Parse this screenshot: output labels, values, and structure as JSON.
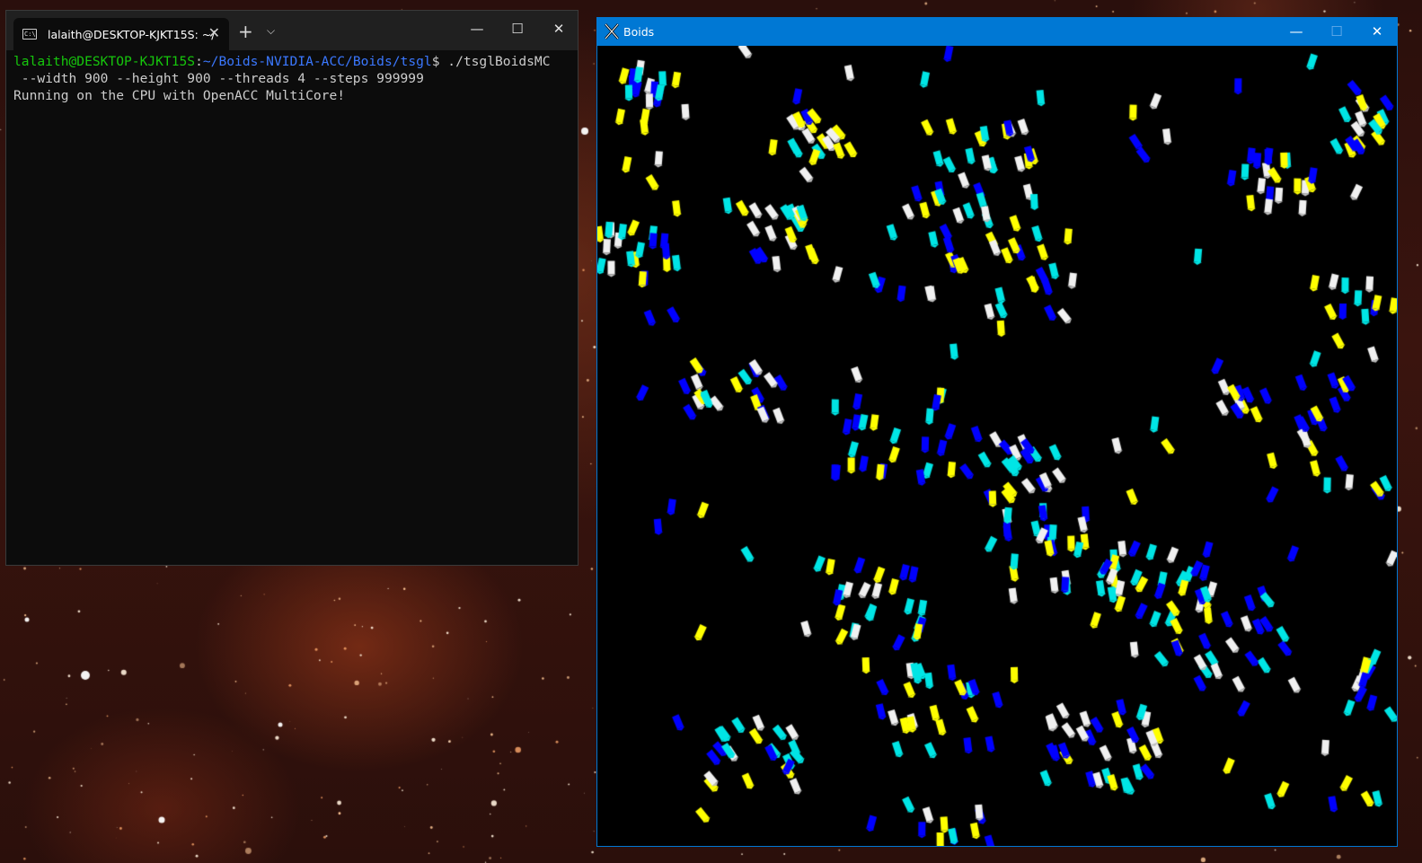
{
  "terminal": {
    "tab_title": "lalaith@DESKTOP-KJKT15S: ~/",
    "tab_icon_text": "C:\\",
    "new_tab": "+",
    "dropdown": "⌄",
    "prompt_user": "lalaith@DESKTOP-KJKT15S",
    "prompt_sep": ":",
    "prompt_path": "~/Boids-NVIDIA-ACC/Boids/tsgl",
    "prompt_symbol": "$",
    "command": " ./tsglBoidsMC",
    "command_cont": " --width 900 --height 900 --threads 4 --steps 999999",
    "output": "Running on the CPU with OpenACC MultiCore!",
    "minimize": "—",
    "maximize": "☐",
    "close": "✕"
  },
  "boids_window": {
    "title": "Boids",
    "icon": "x-app-icon",
    "minimize": "—",
    "maximize": "☐",
    "close": "✕",
    "boid_colors": [
      "#ffff00",
      "#00e5e5",
      "#0000ff",
      "#f0f0f0"
    ]
  }
}
